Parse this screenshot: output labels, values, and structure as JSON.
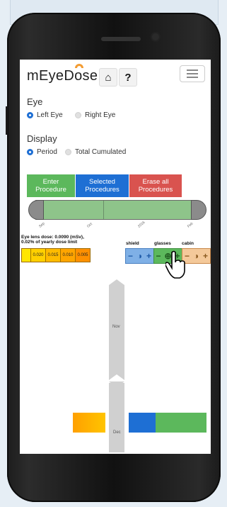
{
  "app": {
    "title_prefix": "mEyeD",
    "title_o": "o",
    "title_suffix": "se"
  },
  "header": {
    "home_icon": "⌂",
    "help_label": "?",
    "menu_icon": "hamburger-icon"
  },
  "eye": {
    "heading": "Eye",
    "options": [
      {
        "label": "Left Eye",
        "selected": true
      },
      {
        "label": "Right Eye",
        "selected": false
      }
    ]
  },
  "display": {
    "heading": "Display",
    "options": [
      {
        "label": "Period",
        "selected": true
      },
      {
        "label": "Total Cumulated",
        "selected": false
      }
    ]
  },
  "buttons": {
    "enter": "Enter Procedure",
    "selected": "Selected Procedures",
    "erase": "Erase all Procedures"
  },
  "timeline": {
    "ticks": [
      "Sep",
      "Oct",
      "2016",
      "Feb"
    ]
  },
  "dose": {
    "line1": "Eye lens dose: 0.0090 (mSv),",
    "line2": "0.02% of yearly dose limit",
    "scale": [
      "",
      "0.020",
      "0.015",
      "0.010",
      "0.005"
    ]
  },
  "protection": {
    "shield": "shield",
    "glasses": "glasses",
    "cabin": "cabin"
  },
  "months": {
    "nov": "Nov",
    "dec": "Dec"
  },
  "colors": {
    "green": "#5cb85c",
    "blue": "#1e6fd4",
    "red": "#d9534f",
    "orange": "#f0a020"
  }
}
